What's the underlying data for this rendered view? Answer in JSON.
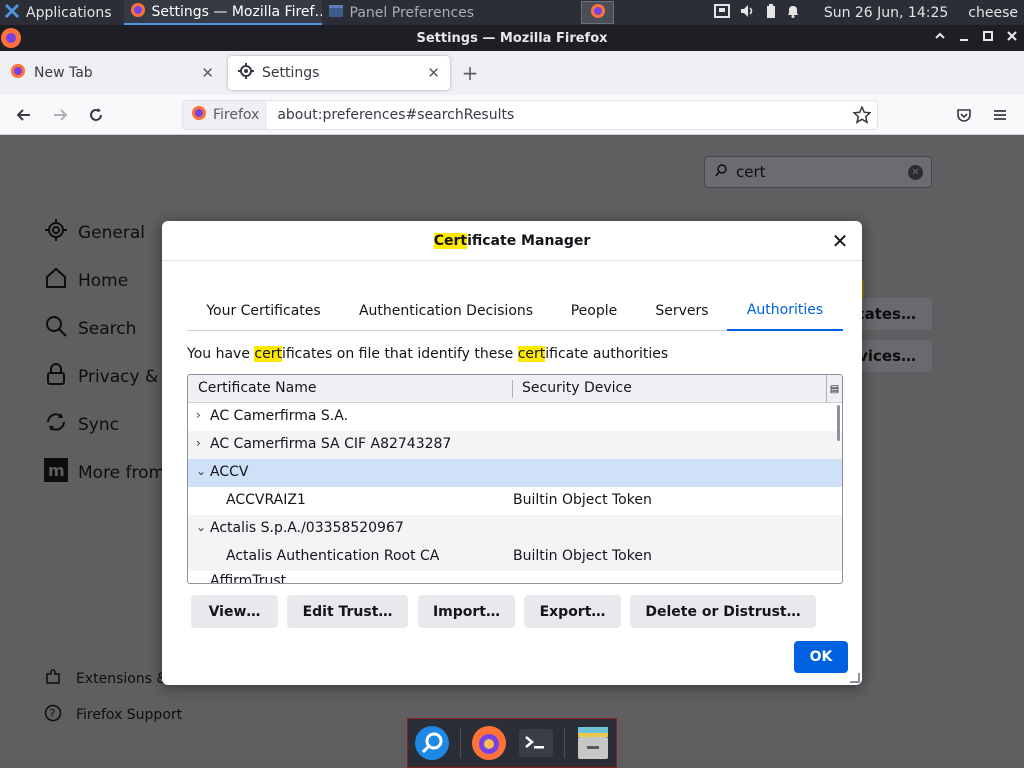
{
  "system_panel": {
    "apps_label": "Applications",
    "task_active": "Settings — Mozilla Firef…",
    "task_inactive": "Panel Preferences",
    "datetime": "Sun 26 Jun, 14:25",
    "user": "cheese"
  },
  "window": {
    "title": "Settings — Mozilla Firefox"
  },
  "tabs": [
    {
      "label": "New Tab"
    },
    {
      "label": "Settings"
    }
  ],
  "urlbar": {
    "identity": "Firefox",
    "url": "about:preferences#searchResults"
  },
  "prefs": {
    "search_value": "cert",
    "sidebar": [
      "General",
      "Home",
      "Search",
      "Privacy & S",
      "Sync",
      "More from"
    ],
    "footer": [
      "Extensions &",
      "Firefox Support"
    ],
    "bg_buttons": [
      "cates…",
      "vices…"
    ]
  },
  "dialog": {
    "title_hl": "Cert",
    "title_rest": "ificate Manager",
    "tabs": [
      "Your Certificates",
      "Authentication Decisions",
      "People",
      "Servers",
      "Authorities"
    ],
    "desc": {
      "p1": "You have ",
      "h1": "cert",
      "p2": "ificates on file that identify these ",
      "h2": "cert",
      "p3": "ificate authorities"
    },
    "columns": {
      "name": "Certificate Name",
      "device": "Security Device"
    },
    "rows": [
      {
        "twisty": "›",
        "name": "AC Camerfirma S.A.",
        "device": ""
      },
      {
        "twisty": "›",
        "name": "AC Camerfirma SA CIF A82743287",
        "device": ""
      },
      {
        "twisty": "⌄",
        "name": "ACCV",
        "device": ""
      },
      {
        "twisty": "",
        "name": "ACCVRAIZ1",
        "device": "Builtin Object Token"
      },
      {
        "twisty": "⌄",
        "name": "Actalis S.p.A./03358520967",
        "device": ""
      },
      {
        "twisty": "",
        "name": "Actalis Authentication Root CA",
        "device": "Builtin Object Token"
      },
      {
        "twisty": "",
        "name": "AffirmTrust",
        "device": ""
      }
    ],
    "buttons": [
      "View…",
      "Edit Trust…",
      "Import…",
      "Export…",
      "Delete or Distrust…"
    ],
    "ok": "OK"
  },
  "colors": {
    "accent": "#0061e0",
    "highlight": "#ffe900",
    "selected_row": "#cfe1f6"
  }
}
